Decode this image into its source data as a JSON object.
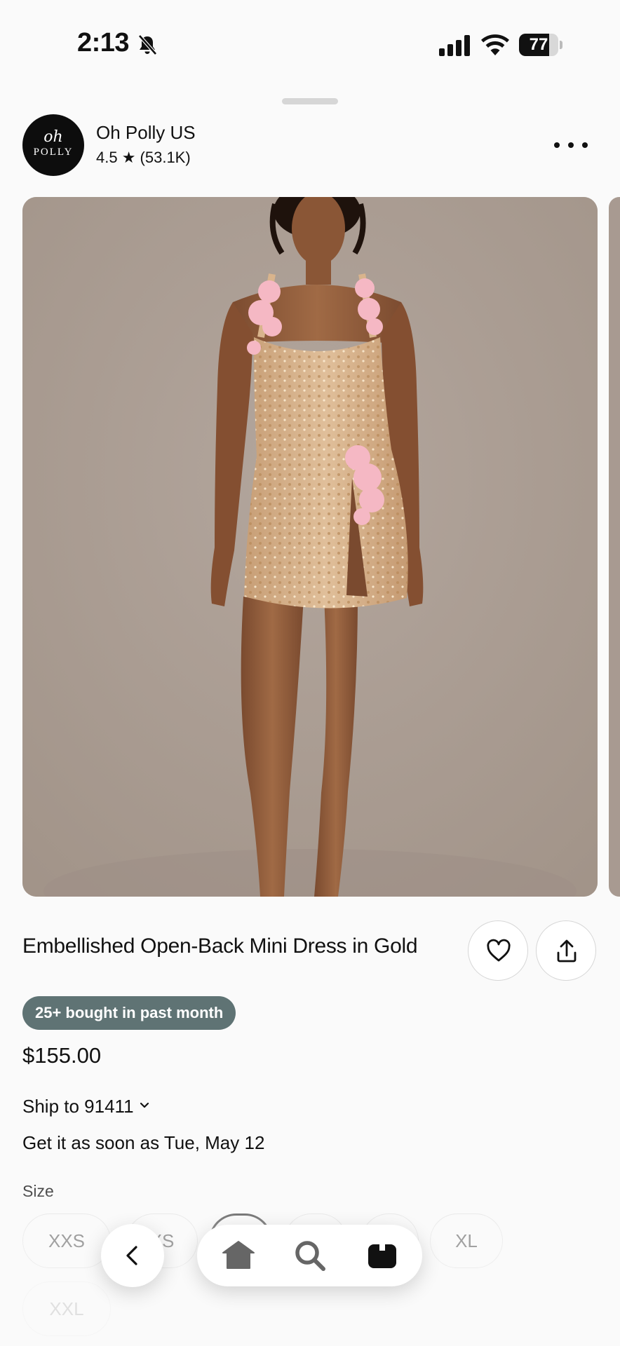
{
  "status_bar": {
    "time": "2:13",
    "battery": "77",
    "battery_level": 0.77
  },
  "seller": {
    "logo_script": "oh",
    "logo_word": "POLLY",
    "name": "Oh Polly US",
    "rating": "4.5 ★ (53.1K)"
  },
  "product": {
    "title": "Embellished Open-Back Mini Dress in Gold",
    "badge": "25+ bought in past month",
    "price": "$155.00",
    "ship_to": "Ship to 91411",
    "delivery": "Get it as soon as Tue, May 12",
    "size_label": "Size"
  },
  "sizes": [
    {
      "label": "XXS"
    },
    {
      "label": "XS"
    },
    {
      "label": ""
    },
    {
      "label": ""
    },
    {
      "label": ""
    },
    {
      "label": "XL"
    },
    {
      "label": "XXL"
    }
  ],
  "colors": {
    "badge": "#5f7374",
    "image_bg": "#ab9e95",
    "dress": "#d8b48e",
    "flower": "#f5b8c4"
  },
  "nav": {
    "back": "back-icon",
    "home": "home-icon",
    "search": "search-icon",
    "bag": "bag-icon"
  }
}
